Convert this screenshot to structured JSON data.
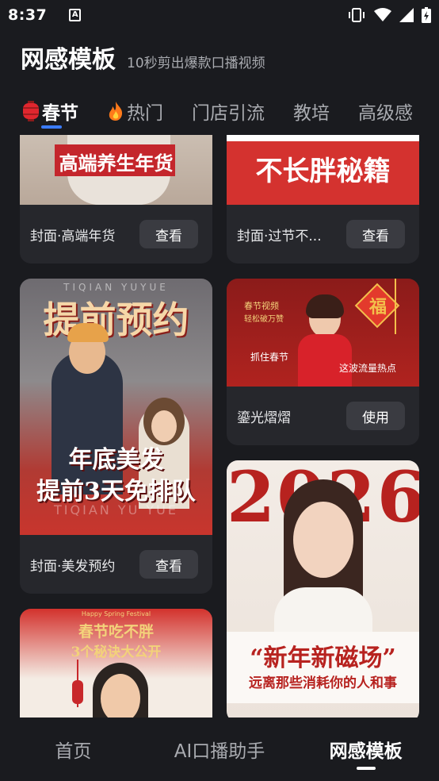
{
  "status_bar": {
    "time": "8:37",
    "notification_icon": "a-icon"
  },
  "header": {
    "title": "网感模板",
    "subtitle": "10秒剪出爆款口播视频"
  },
  "tabs": [
    {
      "label": "春节",
      "icon": "lantern-icon",
      "active": true
    },
    {
      "label": "热门",
      "icon": "fire-icon",
      "active": false
    },
    {
      "label": "门店引流",
      "active": false
    },
    {
      "label": "教培",
      "active": false
    },
    {
      "label": "高级感",
      "active": false
    }
  ],
  "cards": {
    "c1": {
      "title": "封面·高端年货",
      "button": "查看",
      "poster_text": "高端养生年货"
    },
    "c2": {
      "title": "封面·过节不...",
      "button": "查看",
      "poster_text": "不长胖秘籍"
    },
    "c3": {
      "title": "封面·美发预约",
      "button": "查看",
      "poster_title": "提前预约",
      "poster_line1": "年底美发",
      "poster_line2": "提前3天免排队",
      "poster_pinyin_top": "TIQIAN YUYUE",
      "poster_pinyin_bottom": "TIQIAN YU YUE"
    },
    "c4": {
      "title": "鎏光熠熠",
      "button": "使用",
      "poster_left_top": "春节视频",
      "poster_left_sub": "轻松破万赞",
      "poster_caption_left": "抓住春节",
      "poster_caption_right": "这波流量热点",
      "poster_fu": "福"
    },
    "c5": {
      "poster_small": "Happy Spring Festival",
      "poster_line1": "春节吃不胖",
      "poster_line2": "3个秘诀大公开"
    },
    "c6": {
      "poster_year": "2026",
      "poster_title": "“新年新磁场”",
      "poster_sub": "远离那些消耗你的人和事"
    }
  },
  "bottom_nav": [
    {
      "label": "首页",
      "active": false
    },
    {
      "label": "AI口播助手",
      "active": false
    },
    {
      "label": "网感模板",
      "active": true
    }
  ],
  "colors": {
    "background": "#1a1b1f",
    "card": "#26272c",
    "button": "#3a3b41",
    "accent_blue": "#3b7cff",
    "festive_red": "#c8282b"
  }
}
